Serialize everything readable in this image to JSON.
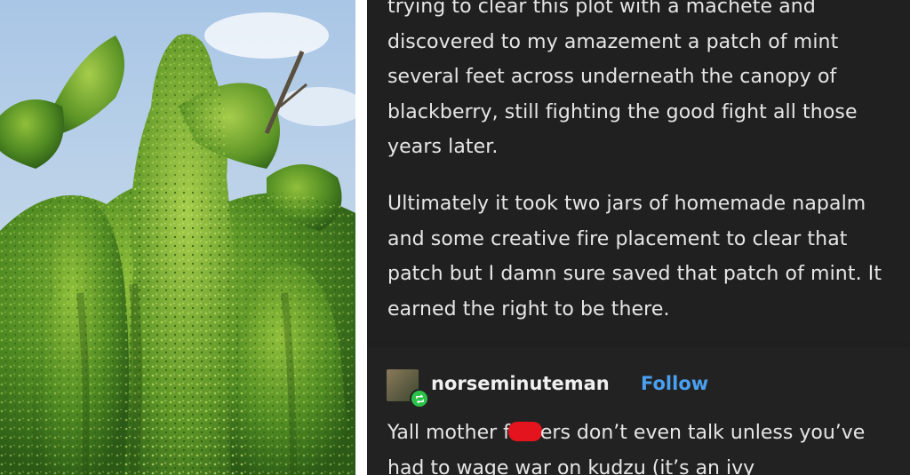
{
  "photo": {
    "description_icon": "kudzu-covered-tree-photo"
  },
  "post": {
    "paragraphs": [
      "trying to clear this plot with a machete and discovered to my amazement a patch of mint several feet across underneath the canopy of blackberry, still fighting the good fight all those years later.",
      "Ultimately it took two jars of homemade napalm and some creative fire placement to clear that patch but I damn sure saved that patch of mint. It earned the right to be there."
    ]
  },
  "reply": {
    "username": "norseminuteman",
    "follow_label": "Follow",
    "text_before": "Yall mother f",
    "text_after": "ers don’t even talk unless you’ve had to wage war on kudzu (it’s an ivy"
  },
  "colors": {
    "panel_bg": "#202020",
    "text": "#e6e6e6",
    "follow": "#4aa0f0",
    "reblog_badge": "#2cc24a",
    "redaction": "#e4141e"
  }
}
